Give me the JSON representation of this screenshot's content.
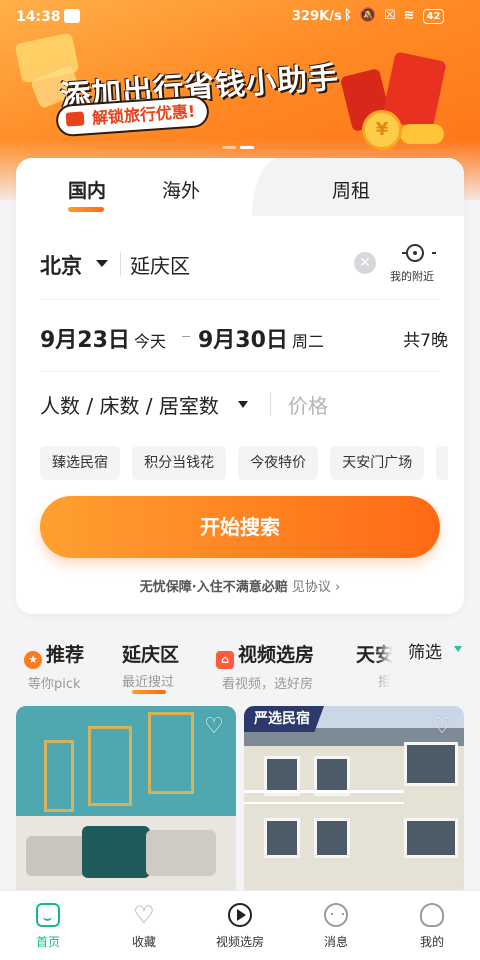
{
  "status_bar": {
    "time": "14:38",
    "net_speed": "329K/s",
    "battery": "42"
  },
  "banner": {
    "title": "添加出行省钱小助手",
    "subtitle": "解锁旅行优惠!",
    "coin_symbol": "¥"
  },
  "search_card": {
    "tabs": [
      {
        "label": "国内",
        "active": true
      },
      {
        "label": "海外",
        "active": false
      },
      {
        "label": "周租",
        "active": false
      }
    ],
    "city": "北京",
    "district": "延庆区",
    "nearby_label": "我的附近",
    "checkin_date": "9月23日",
    "checkin_note": "今天",
    "checkout_date": "9月30日",
    "checkout_note": "周二",
    "nights": "共7晚",
    "people_label": "人数 / 床数 / 居室数",
    "price_placeholder": "价格",
    "quick_tags": [
      "臻选民宿",
      "积分当钱花",
      "今夜特价",
      "天安门广场",
      "前"
    ],
    "search_button": "开始搜索",
    "guarantee_text": "无忧保障·入住不满意必赔",
    "agreement_link": "见协议 ›"
  },
  "categories": [
    {
      "title": "推荐",
      "subtitle": "等你pick"
    },
    {
      "title": "延庆区",
      "subtitle": "最近搜过"
    },
    {
      "title": "视频选房",
      "subtitle": "看视频，选好房"
    },
    {
      "title": "天安",
      "subtitle": "拒"
    }
  ],
  "filter_label": "筛选",
  "listings": [
    {
      "badge": ""
    },
    {
      "badge": "严选民宿"
    }
  ],
  "bottom_nav": [
    {
      "label": "首页",
      "active": true
    },
    {
      "label": "收藏",
      "active": false
    },
    {
      "label": "视频选房",
      "active": false
    },
    {
      "label": "消息",
      "active": false
    },
    {
      "label": "我的",
      "active": false
    }
  ],
  "colors": {
    "accent_orange": "#ff6a14",
    "accent_green": "#18b98f"
  }
}
